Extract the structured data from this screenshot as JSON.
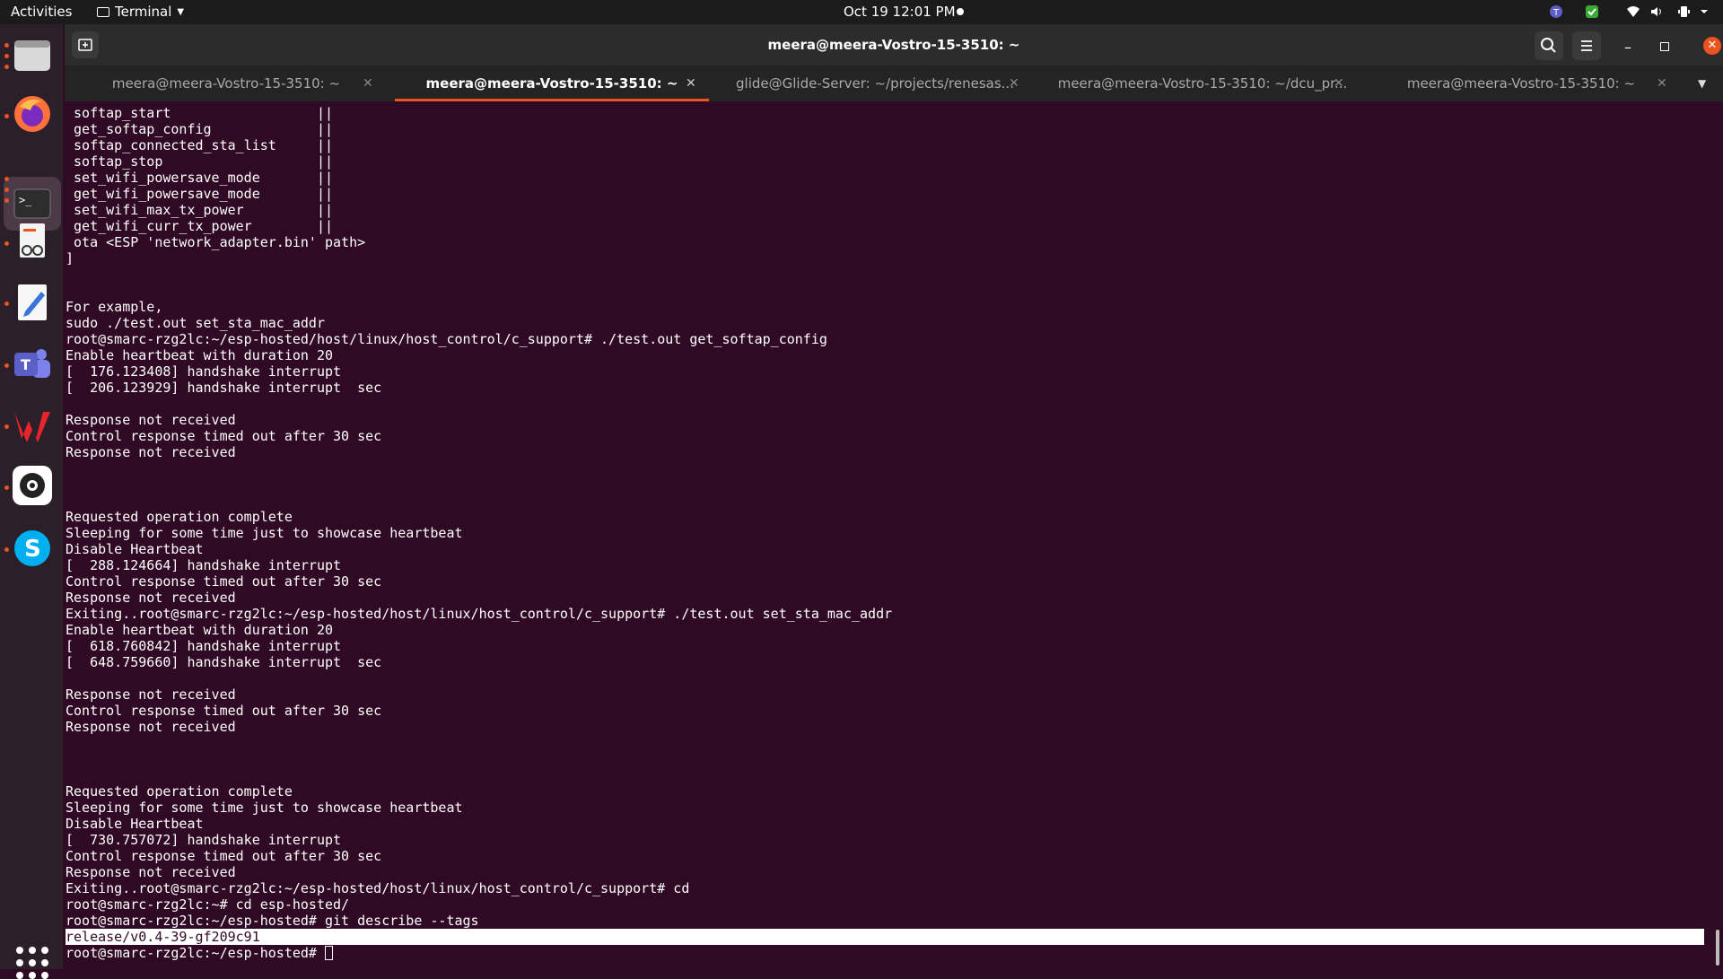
{
  "topbar": {
    "activities": "Activities",
    "app_name": "Terminal",
    "clock": "Oct 19  12:01 PM"
  },
  "window": {
    "title": "meera@meera-Vostro-15-3510: ~"
  },
  "tabs": [
    {
      "label": "meera@meera-Vostro-15-3510: ~",
      "active": false
    },
    {
      "label": "meera@meera-Vostro-15-3510: ~",
      "active": true
    },
    {
      "label": "glide@Glide-Server: ~/projects/renesas...",
      "active": false
    },
    {
      "label": "meera@meera-Vostro-15-3510: ~/dcu_pr...",
      "active": false
    },
    {
      "label": "meera@meera-Vostro-15-3510: ~",
      "active": false
    }
  ],
  "dock": {
    "apps": [
      "Files",
      "Firefox",
      "Terminal",
      "Document Viewer",
      "Text Editor",
      "Teams",
      "WPS Office",
      "Settings",
      "Skype"
    ]
  },
  "terminal": {
    "lines": [
      " softap_start                  ||",
      " get_softap_config             ||",
      " softap_connected_sta_list     ||",
      " softap_stop                   ||",
      " set_wifi_powersave_mode       ||",
      " get_wifi_powersave_mode       ||",
      " set_wifi_max_tx_power         ||",
      " get_wifi_curr_tx_power        ||",
      " ota <ESP 'network_adapter.bin' path>",
      "]",
      "",
      "",
      "For example,",
      "sudo ./test.out set_sta_mac_addr",
      "root@smarc-rzg2lc:~/esp-hosted/host/linux/host_control/c_support# ./test.out get_softap_config",
      "Enable heartbeat with duration 20",
      "[  176.123408] handshake interrupt",
      "[  206.123929] handshake interrupt  sec",
      "",
      "Response not received",
      "Control response timed out after 30 sec",
      "Response not received",
      "",
      "",
      "",
      "Requested operation complete",
      "Sleeping for some time just to showcase heartbeat",
      "Disable Heartbeat",
      "[  288.124664] handshake interrupt",
      "Control response timed out after 30 sec",
      "Response not received",
      "Exiting..root@smarc-rzg2lc:~/esp-hosted/host/linux/host_control/c_support# ./test.out set_sta_mac_addr",
      "Enable heartbeat with duration 20",
      "[  618.760842] handshake interrupt",
      "[  648.759660] handshake interrupt  sec",
      "",
      "Response not received",
      "Control response timed out after 30 sec",
      "Response not received",
      "",
      "",
      "",
      "Requested operation complete",
      "Sleeping for some time just to showcase heartbeat",
      "Disable Heartbeat",
      "[  730.757072] handshake interrupt",
      "Control response timed out after 30 sec",
      "Response not received",
      "Exiting..root@smarc-rzg2lc:~/esp-hosted/host/linux/host_control/c_support# cd",
      "root@smarc-rzg2lc:~# cd esp-hosted/",
      "root@smarc-rzg2lc:~/esp-hosted# git describe --tags",
      "release/v0.4-39-gf209c91"
    ],
    "highlighted_line": "release/v0.4-39-gf209c91",
    "prompt": "root@smarc-rzg2lc:~/esp-hosted# "
  }
}
